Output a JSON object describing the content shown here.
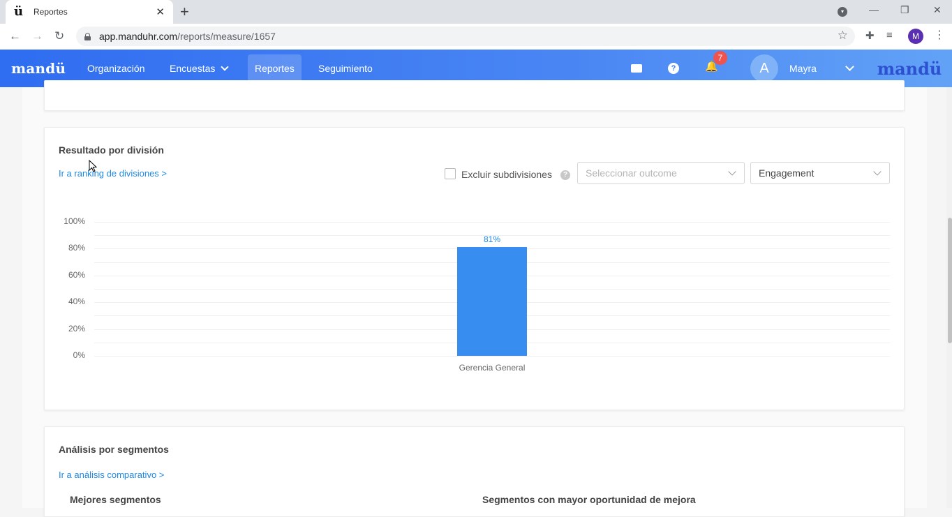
{
  "browser": {
    "tab_title": "Reportes",
    "tab_favicon": "ü",
    "url_host": "app.manduhr.com",
    "url_path": "/reports/measure/1657",
    "profile_initial": "M"
  },
  "header": {
    "logo": "mandü",
    "nav": [
      "Organización",
      "Encuestas",
      "Reportes",
      "Seguimiento"
    ],
    "active_nav": "Reportes",
    "notification_count": "7",
    "user_initial": "A",
    "user_name": "Mayra",
    "client_logo": "mandü",
    "accent_color": "#2f6df1"
  },
  "division_card": {
    "title": "Resultado por división",
    "link": "Ir a ranking de divisiones >",
    "checkbox_label": "Excluir subdivisiones",
    "help_glyph": "?",
    "outcome_placeholder": "Seleccionar outcome",
    "metric_value": "Engagement"
  },
  "chart_data": {
    "type": "bar",
    "categories": [
      "Gerencia General"
    ],
    "values": [
      81
    ],
    "data_labels": [
      "81%"
    ],
    "y_ticks": [
      "100%",
      "80%",
      "60%",
      "40%",
      "20%",
      "0%"
    ],
    "ylim": [
      0,
      100
    ],
    "bar_color": "#378ef0",
    "grid": true
  },
  "segments_card": {
    "title": "Análisis por segmentos",
    "link": "Ir a análisis comparativo >",
    "left_heading": "Mejores segmentos",
    "right_heading": "Segmentos con mayor oportunidad de mejora"
  }
}
